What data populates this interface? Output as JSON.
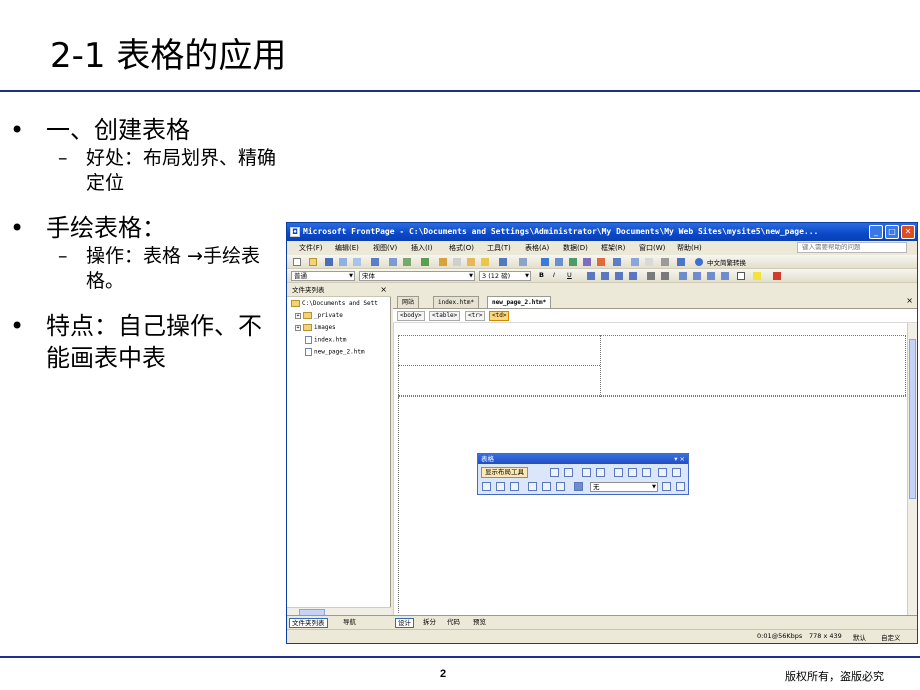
{
  "slide": {
    "title": "2-1 表格的应用",
    "bullets": [
      {
        "text": "一、创建表格",
        "sub": [
          "好处：布局划界、精确定位"
        ]
      },
      {
        "text": "手绘表格：",
        "sub": [
          "操作：表格 →手绘表格。"
        ]
      },
      {
        "text": "特点：自己操作、不能画表中表",
        "sub": []
      }
    ],
    "bullet_glyph": "•",
    "dash_glyph": "–",
    "page_number": "2",
    "copyright": "版权所有，盗版必究",
    "accent_color": "#1f2f8f"
  },
  "app": {
    "title": "Microsoft FrontPage - C:\\Documents and Settings\\Administrator\\My Documents\\My Web Sites\\mysite5\\new_page...",
    "window_buttons": {
      "minimize": "_",
      "maximize": "□",
      "close": "✕"
    },
    "menu": [
      "文件(F)",
      "编辑(E)",
      "视图(V)",
      "插入(I)",
      "格式(O)",
      "工具(T)",
      "表格(A)",
      "数据(D)",
      "框架(R)",
      "窗口(W)",
      "帮助(H)"
    ],
    "help_placeholder": "键入需要帮助的问题",
    "toolbar1_convert": "中文简繁转换",
    "format_bar": {
      "style": "普通",
      "font": "宋体",
      "size": "3 (12 磅)"
    },
    "folder_pane": {
      "title": "文件夹列表",
      "root": "C:\\Documents and Sett",
      "items": [
        "_private",
        "images",
        "index.htm",
        "new_page_2.htm"
      ]
    },
    "doc_tabs": [
      "网站",
      "index.htm*",
      "new_page_2.htm*"
    ],
    "tag_path": [
      "<body>",
      "<table>",
      "<tr>",
      "<td>"
    ],
    "table_toolbar": {
      "title": "表格",
      "show_layout": "显示布局工具",
      "color_value": "无"
    },
    "view_buttons": [
      "设计",
      "拆分",
      "代码",
      "预览"
    ],
    "pane_tabs": [
      "文件夹列表",
      "导航"
    ],
    "status": {
      "speed": "0:01@56Kbps",
      "dims": "778 x 439",
      "mode1": "默认",
      "mode2": "自定义"
    }
  }
}
